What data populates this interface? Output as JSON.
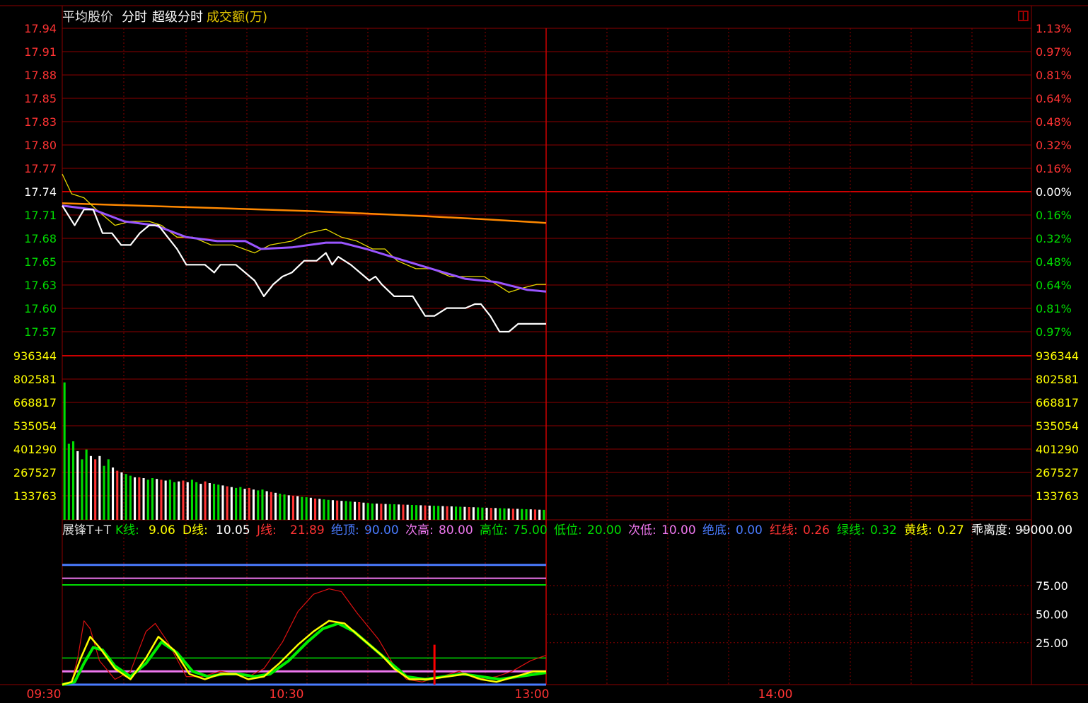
{
  "header": {
    "avg_price_label": "平均股价",
    "fenshi_label": "分时",
    "super_fenshi_label": "超级分时",
    "volume_label": "成交额(万)"
  },
  "price_axis": {
    "left_ticks": [
      "17.94",
      "17.91",
      "17.88",
      "17.85",
      "17.83",
      "17.80",
      "17.77",
      "17.74",
      "17.71",
      "17.68",
      "17.65",
      "17.63",
      "17.60",
      "17.57"
    ],
    "right_ticks": [
      "1.13%",
      "0.97%",
      "0.81%",
      "0.64%",
      "0.48%",
      "0.32%",
      "0.16%",
      "0.00%",
      "0.16%",
      "0.32%",
      "0.48%",
      "0.64%",
      "0.81%",
      "0.97%"
    ],
    "prev_close_index": 7
  },
  "volume_axis": {
    "ticks": [
      "936344",
      "802581",
      "668817",
      "535054",
      "401290",
      "267527",
      "133763"
    ]
  },
  "time_axis": {
    "labels": [
      "09:30",
      "10:30",
      "13:00",
      "14:00"
    ]
  },
  "indicator": {
    "legend": [
      {
        "key": "name",
        "label": "展锋T+T",
        "value": "",
        "color": "#dddddd"
      },
      {
        "key": "k",
        "label": "K线:",
        "value": "9.06",
        "color": "#ffff00",
        "label_color": "#00dd00"
      },
      {
        "key": "d",
        "label": "D线:",
        "value": "10.05",
        "color": "#ffffff",
        "label_color": "#ffff00"
      },
      {
        "key": "j",
        "label": "J线:",
        "value": "21.89",
        "color": "#ff3333",
        "label_color": "#ff3333"
      },
      {
        "key": "top",
        "label": "绝顶:",
        "value": "90.00",
        "color": "#4a7bff",
        "label_color": "#4a7bff"
      },
      {
        "key": "sub_high",
        "label": "次高:",
        "value": "80.00",
        "color": "#ee77ee",
        "label_color": "#ee77ee"
      },
      {
        "key": "high",
        "label": "高位:",
        "value": "75.00",
        "color": "#00dd00",
        "label_color": "#00dd00"
      },
      {
        "key": "low",
        "label": "低位:",
        "value": "20.00",
        "color": "#00dd00",
        "label_color": "#00dd00"
      },
      {
        "key": "sub_low",
        "label": "次低:",
        "value": "10.00",
        "color": "#ee77ee",
        "label_color": "#ee77ee"
      },
      {
        "key": "bottom",
        "label": "绝底:",
        "value": "0.00",
        "color": "#4a7bff",
        "label_color": "#4a7bff"
      },
      {
        "key": "red",
        "label": "红线:",
        "value": "0.26",
        "color": "#ff3333",
        "label_color": "#ff3333"
      },
      {
        "key": "green",
        "label": "绿线:",
        "value": "0.32",
        "color": "#00dd00",
        "label_color": "#00dd00"
      },
      {
        "key": "yellow",
        "label": "黄线:",
        "value": "0.27",
        "color": "#ffff00",
        "label_color": "#ffff00"
      },
      {
        "key": "deviation",
        "label": "乖离度:",
        "value": "99000.00",
        "color": "#ffffff",
        "label_color": "#ffffff"
      }
    ],
    "ticks": [
      "75.00",
      "50.00",
      "25.00"
    ],
    "close_symbol": "×"
  },
  "colors": {
    "grid": "#8b0000",
    "axis_red": "#ff3333",
    "axis_green": "#00dd00",
    "axis_yellow": "#ffff00",
    "price_line": "#ffffff",
    "avg_line": "#9955ff",
    "yellow_line": "#e6d800",
    "orange_line": "#ff8800"
  },
  "chart_data": [
    {
      "type": "line",
      "title": "",
      "prev_close": 17.74,
      "ylim": [
        17.555,
        17.94
      ],
      "x_range": [
        0,
        240
      ],
      "series": [
        {
          "key": "price",
          "values": [
            [
              0,
              17.715
            ],
            [
              8,
              17.69
            ],
            [
              14,
              17.71
            ],
            [
              20,
              17.71
            ],
            [
              26,
              17.68
            ],
            [
              32,
              17.68
            ],
            [
              38,
              17.665
            ],
            [
              44,
              17.665
            ],
            [
              50,
              17.68
            ],
            [
              56,
              17.69
            ],
            [
              62,
              17.69
            ],
            [
              68,
              17.675
            ],
            [
              74,
              17.66
            ],
            [
              80,
              17.64
            ],
            [
              92,
              17.64
            ],
            [
              98,
              17.63
            ],
            [
              102,
              17.64
            ],
            [
              112,
              17.64
            ],
            [
              124,
              17.62
            ],
            [
              130,
              17.6
            ],
            [
              136,
              17.615
            ],
            [
              142,
              17.625
            ],
            [
              148,
              17.63
            ],
            [
              156,
              17.645
            ],
            [
              164,
              17.645
            ],
            [
              170,
              17.655
            ],
            [
              174,
              17.64
            ],
            [
              178,
              17.65
            ],
            [
              186,
              17.64
            ],
            [
              192,
              17.63
            ],
            [
              198,
              17.62
            ],
            [
              202,
              17.625
            ],
            [
              206,
              17.615
            ],
            [
              214,
              17.6
            ],
            [
              226,
              17.6
            ],
            [
              234,
              17.575
            ],
            [
              240,
              17.575
            ],
            [
              248,
              17.585
            ],
            [
              260,
              17.585
            ],
            [
              266,
              17.59
            ],
            [
              270,
              17.59
            ],
            [
              276,
              17.575
            ],
            [
              282,
              17.555
            ],
            [
              288,
              17.555
            ],
            [
              294,
              17.565
            ],
            [
              300,
              17.565
            ],
            [
              312,
              17.565
            ]
          ]
        },
        {
          "key": "avg",
          "values": [
            [
              0,
              17.715
            ],
            [
              20,
              17.71
            ],
            [
              40,
              17.695
            ],
            [
              60,
              17.69
            ],
            [
              80,
              17.675
            ],
            [
              100,
              17.67
            ],
            [
              118,
              17.67
            ],
            [
              128,
              17.66
            ],
            [
              148,
              17.662
            ],
            [
              170,
              17.668
            ],
            [
              180,
              17.668
            ],
            [
              196,
              17.66
            ],
            [
              216,
              17.648
            ],
            [
              236,
              17.636
            ],
            [
              260,
              17.622
            ],
            [
              280,
              17.618
            ],
            [
              300,
              17.608
            ],
            [
              312,
              17.606
            ]
          ]
        },
        {
          "key": "yellow",
          "values": [
            [
              0,
              17.755
            ],
            [
              6,
              17.73
            ],
            [
              14,
              17.725
            ],
            [
              22,
              17.71
            ],
            [
              34,
              17.69
            ],
            [
              44,
              17.695
            ],
            [
              56,
              17.695
            ],
            [
              64,
              17.69
            ],
            [
              74,
              17.675
            ],
            [
              84,
              17.675
            ],
            [
              96,
              17.665
            ],
            [
              110,
              17.665
            ],
            [
              124,
              17.655
            ],
            [
              134,
              17.665
            ],
            [
              148,
              17.67
            ],
            [
              158,
              17.68
            ],
            [
              170,
              17.685
            ],
            [
              180,
              17.675
            ],
            [
              190,
              17.67
            ],
            [
              200,
              17.66
            ],
            [
              208,
              17.66
            ],
            [
              216,
              17.645
            ],
            [
              228,
              17.635
            ],
            [
              238,
              17.635
            ],
            [
              250,
              17.625
            ],
            [
              262,
              17.625
            ],
            [
              272,
              17.625
            ],
            [
              280,
              17.615
            ],
            [
              288,
              17.605
            ],
            [
              296,
              17.61
            ],
            [
              306,
              17.615
            ],
            [
              312,
              17.615
            ]
          ]
        },
        {
          "key": "orange",
          "values": [
            [
              0,
              17.718
            ],
            [
              80,
              17.713
            ],
            [
              160,
              17.708
            ],
            [
              230,
              17.702
            ],
            [
              270,
              17.698
            ],
            [
              312,
              17.693
            ]
          ]
        }
      ]
    },
    {
      "type": "bar",
      "title": "",
      "ylim": [
        0,
        1003226
      ],
      "x_range": [
        0,
        240
      ],
      "values": [
        840000,
        465000,
        480000,
        420000,
        370000,
        430000,
        390000,
        370000,
        390000,
        330000,
        370000,
        320000,
        300000,
        290000,
        280000,
        270000,
        260000,
        260000,
        255000,
        245000,
        255000,
        250000,
        245000,
        240000,
        245000,
        230000,
        235000,
        240000,
        230000,
        245000,
        230000,
        220000,
        235000,
        225000,
        220000,
        215000,
        210000,
        205000,
        200000,
        195000,
        200000,
        190000,
        195000,
        185000,
        180000,
        185000,
        175000,
        170000,
        165000,
        160000,
        155000,
        150000,
        148000,
        145000,
        140000,
        138000,
        135000,
        130000,
        128000,
        125000,
        122000,
        120000,
        118000,
        116000,
        115000,
        112000,
        110000,
        108000,
        105000,
        103000,
        100000,
        99000,
        98000,
        97000,
        96000,
        95000,
        94000,
        93000,
        92000,
        91000,
        90000,
        89000,
        88000,
        87000,
        86000,
        85000,
        84000,
        83000,
        82000,
        81000,
        80000,
        79000,
        78000,
        77000,
        76000,
        75000,
        74000,
        73000,
        72000,
        71000,
        70000,
        69000,
        68000,
        67000,
        66000,
        65000,
        64000,
        63000,
        62000,
        61000
      ]
    },
    {
      "type": "line",
      "title": "",
      "ylim": [
        0,
        100
      ],
      "x_range": [
        0,
        240
      ],
      "levels": [
        90,
        80,
        75,
        20,
        10,
        0
      ],
      "series": [
        {
          "key": "j",
          "values": [
            [
              0,
              0
            ],
            [
              6,
              2
            ],
            [
              10,
              20
            ],
            [
              14,
              48
            ],
            [
              18,
              42
            ],
            [
              24,
              18
            ],
            [
              34,
              4
            ],
            [
              44,
              10
            ],
            [
              54,
              40
            ],
            [
              60,
              46
            ],
            [
              68,
              32
            ],
            [
              80,
              6
            ],
            [
              90,
              6
            ],
            [
              102,
              10
            ],
            [
              112,
              8
            ],
            [
              120,
              6
            ],
            [
              130,
              12
            ],
            [
              142,
              32
            ],
            [
              152,
              55
            ],
            [
              162,
              68
            ],
            [
              172,
              72
            ],
            [
              180,
              70
            ],
            [
              190,
              54
            ],
            [
              204,
              34
            ],
            [
              214,
              14
            ],
            [
              222,
              4
            ],
            [
              232,
              2
            ],
            [
              244,
              6
            ],
            [
              256,
              10
            ],
            [
              268,
              4
            ],
            [
              280,
              6
            ],
            [
              290,
              10
            ],
            [
              302,
              18
            ],
            [
              312,
              22
            ]
          ]
        },
        {
          "key": "k",
          "values": [
            [
              0,
              0
            ],
            [
              6,
              2
            ],
            [
              12,
              20
            ],
            [
              18,
              36
            ],
            [
              24,
              28
            ],
            [
              34,
              12
            ],
            [
              44,
              4
            ],
            [
              54,
              20
            ],
            [
              62,
              36
            ],
            [
              72,
              26
            ],
            [
              82,
              8
            ],
            [
              92,
              4
            ],
            [
              102,
              8
            ],
            [
              112,
              8
            ],
            [
              120,
              4
            ],
            [
              130,
              6
            ],
            [
              140,
              16
            ],
            [
              152,
              30
            ],
            [
              162,
              40
            ],
            [
              172,
              48
            ],
            [
              182,
              46
            ],
            [
              194,
              34
            ],
            [
              206,
              22
            ],
            [
              214,
              12
            ],
            [
              224,
              4
            ],
            [
              236,
              4
            ],
            [
              248,
              6
            ],
            [
              260,
              8
            ],
            [
              270,
              4
            ],
            [
              280,
              2
            ],
            [
              292,
              6
            ],
            [
              304,
              10
            ],
            [
              312,
              10
            ]
          ]
        },
        {
          "key": "d",
          "values": [
            [
              0,
              0
            ],
            [
              8,
              2
            ],
            [
              14,
              16
            ],
            [
              20,
              28
            ],
            [
              26,
              26
            ],
            [
              34,
              14
            ],
            [
              44,
              6
            ],
            [
              54,
              16
            ],
            [
              64,
              32
            ],
            [
              74,
              24
            ],
            [
              84,
              10
            ],
            [
              94,
              6
            ],
            [
              104,
              8
            ],
            [
              114,
              8
            ],
            [
              124,
              6
            ],
            [
              134,
              8
            ],
            [
              146,
              18
            ],
            [
              158,
              32
            ],
            [
              168,
              42
            ],
            [
              178,
              46
            ],
            [
              188,
              40
            ],
            [
              200,
              28
            ],
            [
              212,
              16
            ],
            [
              222,
              6
            ],
            [
              234,
              4
            ],
            [
              246,
              6
            ],
            [
              258,
              8
            ],
            [
              270,
              6
            ],
            [
              282,
              4
            ],
            [
              294,
              6
            ],
            [
              306,
              8
            ],
            [
              312,
              9
            ]
          ]
        },
        {
          "key": "red_signal",
          "values": [
            [
              240,
              0
            ],
            [
              240,
              30
            ]
          ]
        }
      ]
    }
  ]
}
